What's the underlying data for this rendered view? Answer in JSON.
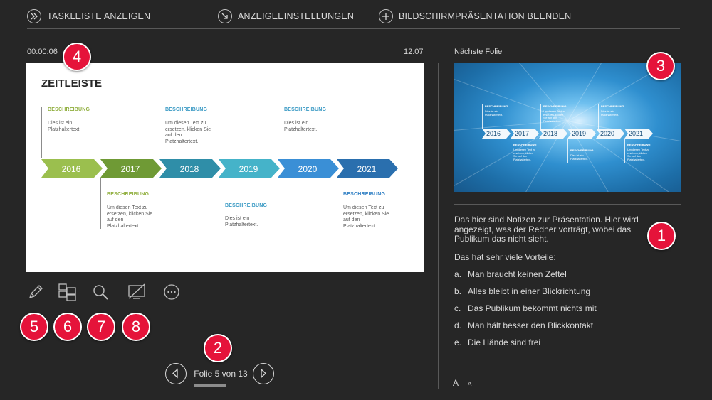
{
  "toolbar": {
    "show_taskbar": "TASKLEISTE ANZEIGEN",
    "display_settings": "ANZEIGEEINSTELLUNGEN",
    "end_show": "BILDSCHIRMPRÄSENTATION BEENDEN"
  },
  "timer": "00:00:06",
  "clock": "12.07",
  "next_slide_label": "Nächste Folie",
  "current_slide": {
    "title": "ZEITLEISTE",
    "years": [
      "2016",
      "2017",
      "2018",
      "2019",
      "2020",
      "2021"
    ],
    "entries": [
      {
        "head": "BESCHREIBUNG",
        "text": "Dies ist ein Platzhaltertext.",
        "color": "#8fae3c"
      },
      {
        "head": "BESCHREIBUNG",
        "text": "Um diesen Text zu ersetzen, klicken Sie auf den Platzhaltertext.",
        "color": "#8fae3c"
      },
      {
        "head": "BESCHREIBUNG",
        "text": "Um diesen Text zu ersetzen, klicken Sie auf den Platzhaltertext.",
        "color": "#3a9ac4"
      },
      {
        "head": "BESCHREIBUNG",
        "text": "Dies ist ein Platzhaltertext.",
        "color": "#3a9ac4"
      },
      {
        "head": "BESCHREIBUNG",
        "text": "Dies ist ein Platzhaltertext.",
        "color": "#3a9ac4"
      },
      {
        "head": "BESCHREIBUNG",
        "text": "Um diesen Text zu ersetzen, klicken Sie auf den Platzhaltertext.",
        "color": "#2f7fc4"
      }
    ],
    "arrow_colors": [
      "#9bbf4e",
      "#6f9a35",
      "#2f8ea8",
      "#45b3c9",
      "#3a8fd6",
      "#2a6fae"
    ]
  },
  "next_slide": {
    "years": [
      "2016",
      "2017",
      "2018",
      "2019",
      "2020",
      "2021"
    ],
    "head": "BESCHREIBUNG",
    "text_short": "Dies ist ein Platzhaltertext.",
    "text_long": "Um diesen Text zu ersetzen, klicken Sie auf den Platzhaltertext."
  },
  "notes": {
    "paragraph1": "Das hier sind Notizen zur Präsentation. Hier wird angezeigt, was der Redner vorträgt, wobei das Publikum das nicht sieht.",
    "paragraph2": "Das hat sehr viele Vorteile:",
    "items": [
      {
        "marker": "a.",
        "text": "Man braucht  keinen Zettel"
      },
      {
        "marker": "b.",
        "text": "Alles bleibt in einer Blickrichtung"
      },
      {
        "marker": "c.",
        "text": "Das Publikum bekommt nichts mit"
      },
      {
        "marker": "d.",
        "text": "Man hält besser den Blickkontakt"
      },
      {
        "marker": "e.",
        "text": "Die Hände sind frei"
      }
    ]
  },
  "tools": [
    "pen-icon",
    "all-slides-icon",
    "zoom-icon",
    "black-screen-icon",
    "more-options-icon"
  ],
  "badges": [
    "1",
    "2",
    "3",
    "4",
    "5",
    "6",
    "7",
    "8"
  ],
  "navigation": {
    "counter": "Folie 5 von 13",
    "progress_fraction": 0.385
  },
  "font_controls": {
    "larger": "A",
    "smaller": "A"
  },
  "colors": {
    "background": "#262626",
    "badge": "#e5133a"
  }
}
